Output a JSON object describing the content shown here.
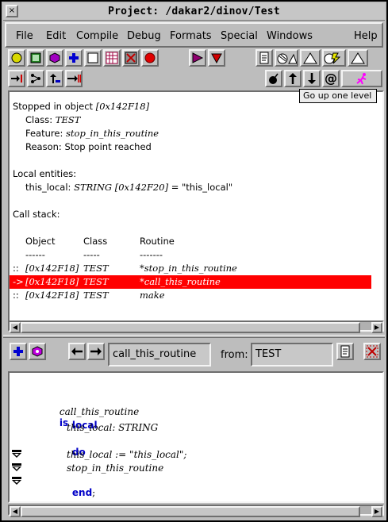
{
  "window": {
    "title": "Project: /dakar2/dinov/Test",
    "close_glyph": "×"
  },
  "menu": [
    "File",
    "Edit",
    "Compile",
    "Debug",
    "Formats",
    "Special",
    "Windows",
    "Help"
  ],
  "tooltip": "Go up one level",
  "output": {
    "stopped_prefix": "Stopped in object",
    "stopped_object": "[0x142F18]",
    "class_label": "Class:",
    "class_value": "TEST",
    "feature_label": "Feature:",
    "feature_value": "stop_in_this_routine",
    "reason_label": "Reason:",
    "reason_value": "Stop point reached",
    "locals_heading": "Local entities:",
    "local_name": "this_local:",
    "local_type": "STRING",
    "local_addr": "[0x142F20]",
    "local_value": "= \"this_local\"",
    "callstack_heading": "Call stack:",
    "columns": [
      "Object",
      "Class",
      "Routine"
    ],
    "dashes": [
      "------",
      "-----",
      "-------"
    ],
    "stack": [
      {
        "marker": "::",
        "object": "[0x142F18]",
        "class": "TEST",
        "routine": "*stop_in_this_routine"
      },
      {
        "marker": "->",
        "object": "[0x142F18]",
        "class": "TEST",
        "routine": "*call_this_routine"
      },
      {
        "marker": "::",
        "object": "[0x142F18]",
        "class": "TEST",
        "routine": "make"
      }
    ]
  },
  "edit_toolbar": {
    "routine_value": "call_this_routine",
    "from_label": "from:",
    "class_value": "TEST"
  },
  "code": {
    "line1_name": "call_this_routine",
    "line1_kw": "is",
    "line2_kw": "local",
    "line3": "this_local: STRING",
    "line4_kw": "do",
    "line5": "this_local := \"this_local\";",
    "line6": "stop_in_this_routine",
    "line7_kw": "end",
    "line7_tail": ";"
  },
  "colors": {
    "current_frame": "#ff0000",
    "keyword": "#0000c8",
    "background": "#bdbdbd"
  }
}
